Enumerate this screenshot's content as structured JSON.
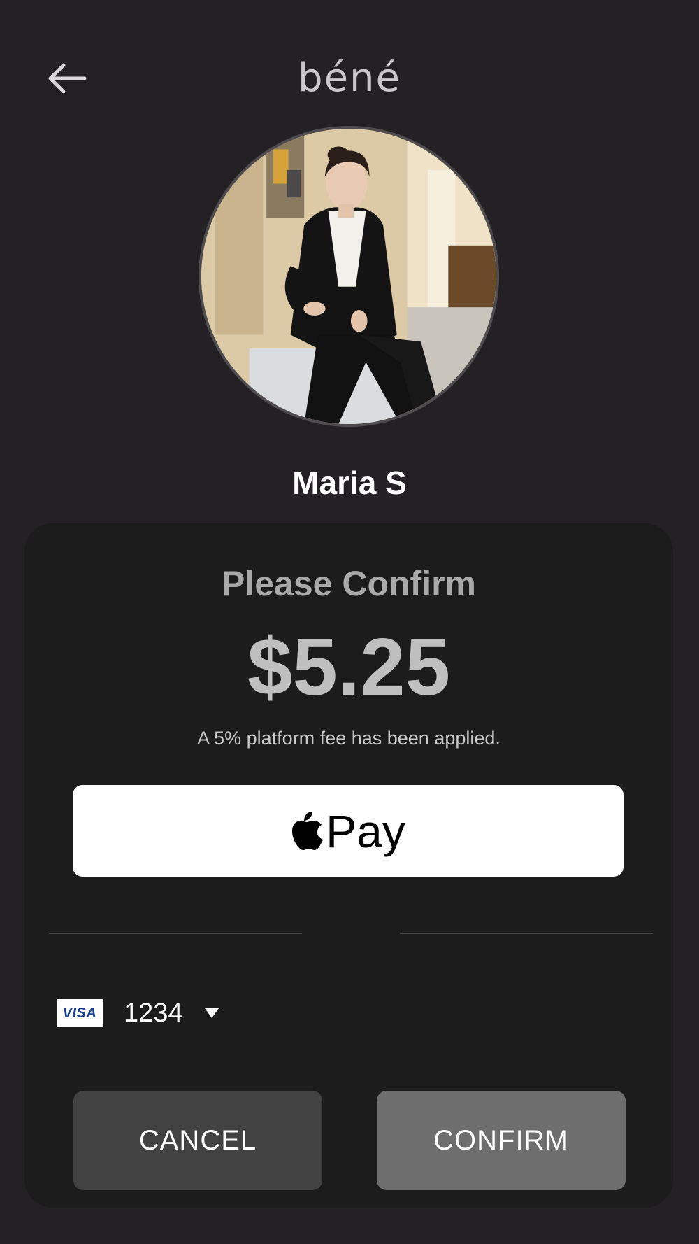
{
  "header": {
    "back_icon": "arrow-left-icon",
    "logo_text": "béné"
  },
  "profile": {
    "avatar_icon": "profile-photo",
    "name": "Maria S"
  },
  "confirm_card": {
    "title": "Please Confirm",
    "amount": "$5.25",
    "fee_note": "A 5% platform fee has been applied.",
    "apple_pay": {
      "icon": "apple-logo-icon",
      "label": "Pay"
    },
    "payment_method": {
      "brand": "VISA",
      "last4": "1234",
      "dropdown_icon": "caret-down-icon"
    },
    "cancel_label": "CANCEL",
    "confirm_label": "CONFIRM"
  },
  "colors": {
    "background": "#232123",
    "card": "#1d1c1d",
    "cancel_button": "#434243",
    "confirm_button": "#6f6e6f",
    "apple_pay_button": "#ffffff"
  }
}
